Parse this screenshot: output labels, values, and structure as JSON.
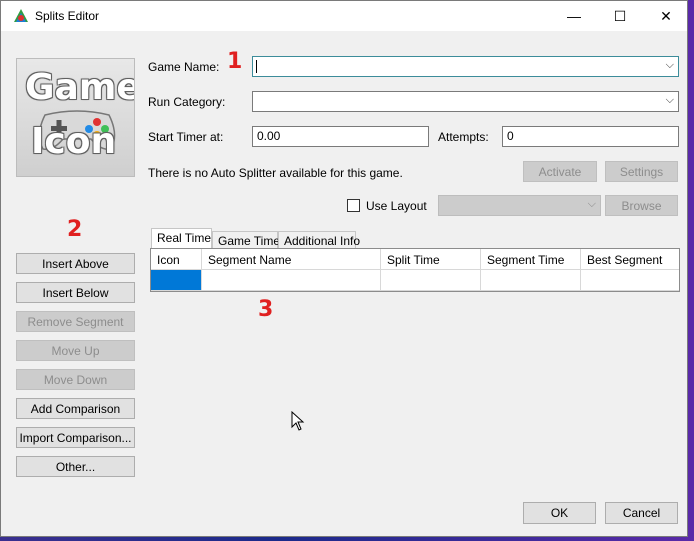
{
  "window": {
    "title": "Splits Editor",
    "controls": {
      "minimize": "—",
      "maximize": "☐",
      "close": "✕"
    }
  },
  "game_icon": {
    "line1": "Game",
    "line2": "Icon"
  },
  "form": {
    "game_name_label": "Game Name:",
    "game_name_value": "",
    "run_category_label": "Run Category:",
    "run_category_value": "",
    "start_timer_label": "Start Timer at:",
    "start_timer_value": "0.00",
    "attempts_label": "Attempts:",
    "attempts_value": "0",
    "auto_splitter_text": "There is no Auto Splitter available for this game.",
    "activate_label": "Activate",
    "settings_label": "Settings",
    "use_layout_label": "Use Layout",
    "layout_value": "",
    "browse_label": "Browse"
  },
  "sidebar": {
    "buttons": [
      {
        "label": "Insert Above",
        "enabled": true
      },
      {
        "label": "Insert Below",
        "enabled": true
      },
      {
        "label": "Remove Segment",
        "enabled": false
      },
      {
        "label": "Move Up",
        "enabled": false
      },
      {
        "label": "Move Down",
        "enabled": false
      },
      {
        "label": "Add Comparison",
        "enabled": true
      },
      {
        "label": "Import Comparison...",
        "enabled": true
      },
      {
        "label": "Other...",
        "enabled": true
      }
    ]
  },
  "tabs": [
    {
      "label": "Real Time",
      "active": true
    },
    {
      "label": "Game Time",
      "active": false
    },
    {
      "label": "Additional Info",
      "active": false
    }
  ],
  "grid": {
    "columns": [
      "Icon",
      "Segment Name",
      "Split Time",
      "Segment Time",
      "Best Segment"
    ]
  },
  "footer": {
    "ok_label": "OK",
    "cancel_label": "Cancel"
  },
  "annotations": {
    "one": "1",
    "two": "2",
    "three": "3"
  },
  "colors": {
    "selection": "#0078d7",
    "annotation_red": "#e02020",
    "focus_border": "#3c8c9a"
  }
}
